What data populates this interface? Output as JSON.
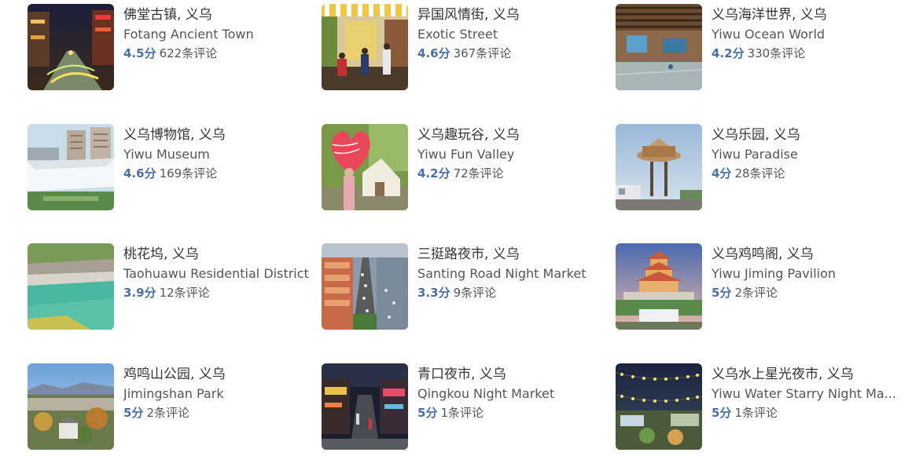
{
  "attractions": [
    {
      "zh": "佛堂古镇, 义乌",
      "en": "Fotang Ancient Town",
      "rating": "4.5分",
      "reviews": "622条评论",
      "image": "night-old-town-photo"
    },
    {
      "zh": "异国风情街, 义乌",
      "en": "Exotic Street",
      "rating": "4.6分",
      "reviews": "367条评论",
      "image": "street-cafe-photo"
    },
    {
      "zh": "义乌海洋世界, 义乌",
      "en": "Yiwu Ocean World",
      "rating": "4.2分",
      "reviews": "330条评论",
      "image": "aquarium-hall-photo"
    },
    {
      "zh": "义乌博物馆, 义乌",
      "en": "Yiwu Museum",
      "rating": "4.6分",
      "reviews": "169条评论",
      "image": "museum-building-photo"
    },
    {
      "zh": "义乌趣玩谷, 义乌",
      "en": "Yiwu Fun Valley",
      "rating": "4.2分",
      "reviews": "72条评论",
      "image": "heart-balloon-photo"
    },
    {
      "zh": "义乌乐园, 义乌",
      "en": "Yiwu Paradise",
      "rating": "4分",
      "reviews": "28条评论",
      "image": "observation-tower-photo"
    },
    {
      "zh": "桃花坞, 义乌",
      "en": "Taohuawu Residential District",
      "rating": "3.9分",
      "reviews": "12条评论",
      "image": "green-lake-photo"
    },
    {
      "zh": "三挺路夜市, 义乌",
      "en": "Santing Road Night Market",
      "rating": "3.3分",
      "reviews": "9条评论",
      "image": "aerial-street-photo"
    },
    {
      "zh": "义乌鸡鸣阁, 义乌",
      "en": "Yiwu Jiming Pavilion",
      "rating": "5分",
      "reviews": "2条评论",
      "image": "pagoda-pavilion-photo"
    },
    {
      "zh": "鸡鸣山公园, 义乌",
      "en": "Jimingshan Park",
      "rating": "5分",
      "reviews": "2条评论",
      "image": "park-aerial-photo"
    },
    {
      "zh": "青口夜市, 义乌",
      "en": "Qingkou Night Market",
      "rating": "5分",
      "reviews": "1条评论",
      "image": "night-market-street-photo"
    },
    {
      "zh": "义乌水上星光夜市, 义乌",
      "en": "Yiwu Water Starry Night Ma...",
      "rating": "5分",
      "reviews": "1条评论",
      "image": "string-lights-market-photo"
    }
  ],
  "colors": {
    "rating": "#4a6fa5",
    "title": "#333333",
    "subtitle": "#555555"
  }
}
